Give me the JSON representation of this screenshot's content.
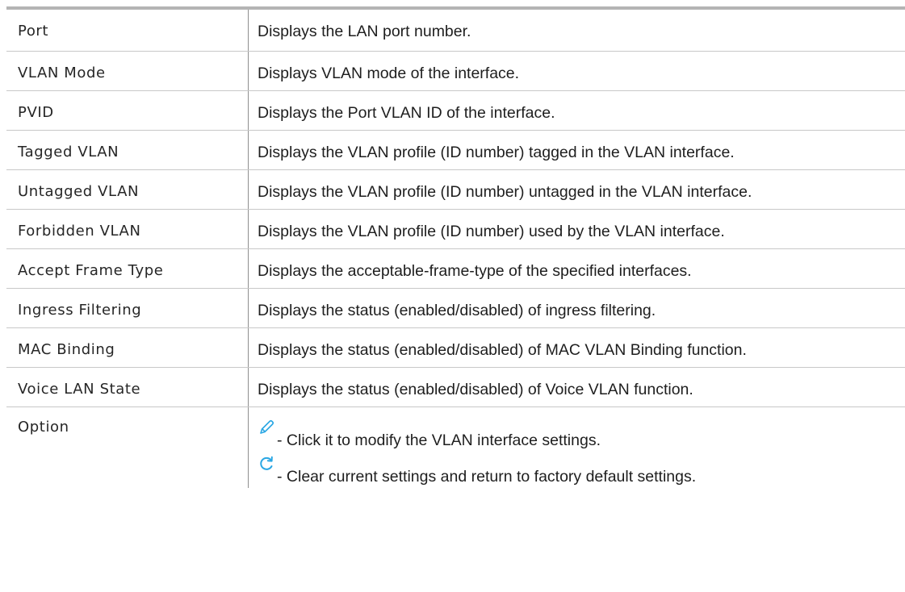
{
  "rows": [
    {
      "term": "Port",
      "desc": "Displays the LAN port number."
    },
    {
      "term": "VLAN Mode",
      "desc": "Displays VLAN mode of the interface."
    },
    {
      "term": "PVID",
      "desc": "Displays the Port VLAN ID of the interface."
    },
    {
      "term": "Tagged VLAN",
      "desc": "Displays the VLAN profile (ID number) tagged in the VLAN interface."
    },
    {
      "term": "Untagged VLAN",
      "desc": "Displays the VLAN profile (ID number) untagged in the VLAN interface."
    },
    {
      "term": "Forbidden VLAN",
      "desc": "Displays the VLAN profile (ID number) used by the VLAN interface."
    },
    {
      "term": "Accept Frame Type",
      "desc": "Displays the acceptable-frame-type of the specified interfaces."
    },
    {
      "term": "Ingress Filtering",
      "desc": "Displays the status (enabled/disabled) of ingress filtering."
    },
    {
      "term": "MAC Binding",
      "desc": "Displays the status (enabled/disabled) of MAC VLAN Binding function."
    },
    {
      "term": "Voice LAN State",
      "desc": "Displays the status (enabled/disabled) of Voice VLAN function."
    }
  ],
  "option": {
    "term": "Option",
    "items": [
      {
        "icon": "pencil-icon",
        "text": "- Click it to modify the VLAN interface settings."
      },
      {
        "icon": "refresh-icon",
        "text": "- Clear current settings and return to factory default settings."
      }
    ]
  },
  "colors": {
    "icon_blue": "#2aa7e4",
    "header_rule": "#b4b4b4"
  }
}
